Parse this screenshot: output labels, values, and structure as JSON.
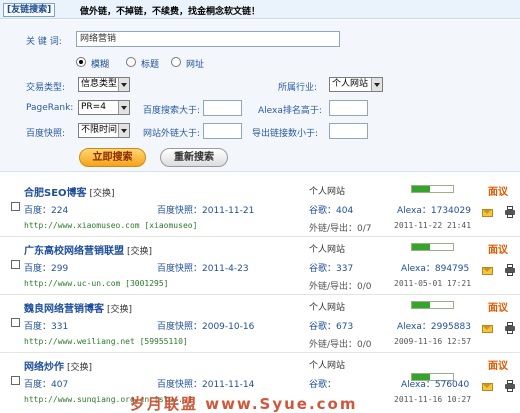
{
  "header": {
    "tab_label": "[友链搜索]",
    "slogan": "做外链，不掉链，不续费，找金桐念软文链！"
  },
  "search": {
    "keyword_label": "关 键 词:",
    "keyword_value": "网络营销",
    "mode_options": [
      {
        "label": "模糊",
        "selected": true
      },
      {
        "label": "标题",
        "selected": false
      },
      {
        "label": "网址",
        "selected": false
      }
    ],
    "trade_type_label": "交易类型:",
    "trade_type_value": "信息类型",
    "industry_label": "所属行业:",
    "industry_value": "个人网站",
    "pagerank_label": "PageRank:",
    "pagerank_value": "PR=4",
    "baidu_search_label": "百度搜索大于:",
    "baidu_search_value": "",
    "alexa_label": "Alexa排名高于:",
    "alexa_value": "",
    "snapshot_label": "百度快照:",
    "snapshot_value": "不限时间",
    "site_links_label": "网站外链大于:",
    "site_links_value": "",
    "export_links_label": "导出链接数小于:",
    "export_links_value": "",
    "search_button": "立即搜索",
    "reset_button": "重新搜索"
  },
  "results": [
    {
      "title": "合肥SEO博客",
      "swap": "[交换]",
      "category": "个人网站",
      "rank_level": 0.45,
      "comment": "面议",
      "baidu": "百度：224",
      "snapshot": "百度快照：2011-11-21",
      "google": "谷歌：404",
      "alexa": "Alexa：1734029",
      "url": "http://www.xiaomuseo.com [xiaomuseo]",
      "links": "外链/导出：0/7",
      "date": "2011-11-22 21:41"
    },
    {
      "title": "广东高校网络营销联盟",
      "swap": "[交换]",
      "category": "个人网站",
      "rank_level": 0.45,
      "comment": "面议",
      "baidu": "百度：299",
      "snapshot": "百度快照：2011-4-23",
      "google": "谷歌：337",
      "alexa": "Alexa：894795",
      "url": "http://www.uc-un.com [3001295]",
      "links": "外链/导出：0/0",
      "date": "2011-05-01 17:21"
    },
    {
      "title": "魏良网络营销博客",
      "swap": "[交换]",
      "category": "个人网站",
      "rank_level": 0.45,
      "comment": "面议",
      "baidu": "百度：331",
      "snapshot": "百度快照：2009-10-16",
      "google": "谷歌：673",
      "alexa": "Alexa：2995883",
      "url": "http://www.weiliang.net [59955110]",
      "links": "外链/导出：0/0",
      "date": "2009-11-16 12:57"
    },
    {
      "title": "网络炒作",
      "swap": "[交换]",
      "category": "个人网站",
      "rank_level": 0.45,
      "comment": "面议",
      "baidu": "百度：407",
      "snapshot": "百度快照：2011-11-14",
      "google": "谷歌：",
      "alexa": "Alexa：576040",
      "url": "http://www.sunqiang.org.cn [slu...]",
      "links": "",
      "date": "2011-11-16 10:27"
    }
  ],
  "watermark": "岁月联盟 www.Syue.com"
}
